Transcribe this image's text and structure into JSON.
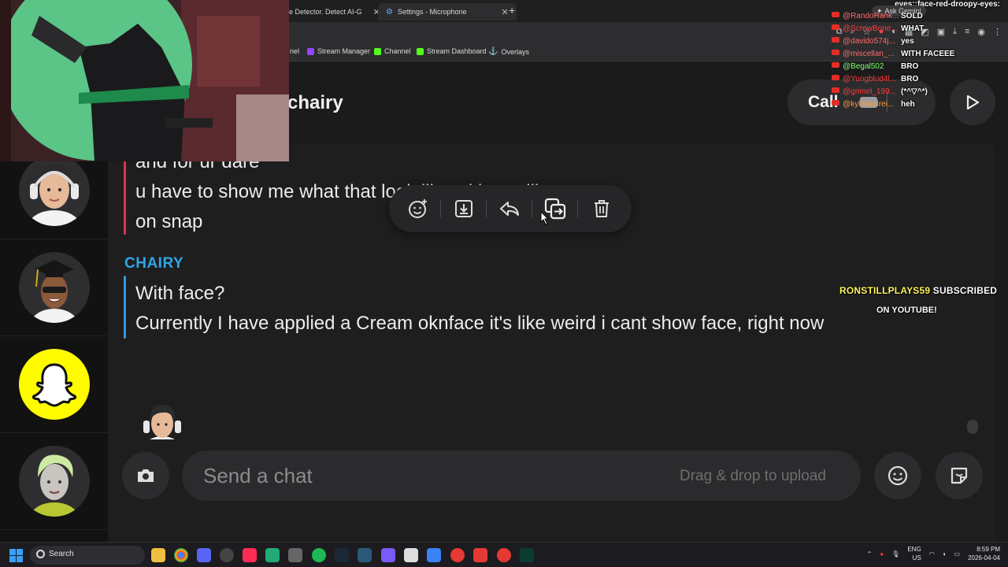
{
  "browser": {
    "tabs": [
      {
        "title": "ge Detector. Detect AI-G"
      },
      {
        "title": "Settings - Microphone"
      }
    ],
    "new_tab": "+",
    "bookmarks": [
      "nel",
      "Stream Manager",
      "Channel",
      "Stream Dashboard",
      "Overlays"
    ],
    "ask_gemini": "Ask Gemini"
  },
  "conversation": {
    "partner_name": "chairy",
    "call_label": "Call",
    "messages_prev": [
      "and for ur dare",
      "u have to show me what that look like with ur gilley",
      "on snap"
    ],
    "sender_name": "CHAIRY",
    "messages_reply": [
      "With face?",
      "Currently I have applied a Cream oknface it's like weird i cant show face, right now"
    ]
  },
  "message_actions": [
    "react",
    "save",
    "reply",
    "copy",
    "delete"
  ],
  "composer": {
    "placeholder": "Send a chat",
    "drag_hint": "Drag & drop to upload"
  },
  "stream_overlay": {
    "header": "eyes::face-red-droopy-eyes:",
    "chat": [
      {
        "user": "@RandoRank...",
        "message": "SOLD",
        "user_color": "#ff6b6b"
      },
      {
        "user": "@ScrewBone...",
        "message": "WHAT",
        "user_color": "#ff3b3b"
      },
      {
        "user": "@davido574j...",
        "message": "yes",
        "user_color": "#ff6b6b"
      },
      {
        "user": "@miscellan_...",
        "message": "WITH FACEEE",
        "user_color": "#ff6b6b"
      },
      {
        "user": "@Begal502",
        "message": "BRO",
        "user_color": "#7dff6b"
      },
      {
        "user": "@Yungblud4l...",
        "message": "BRO",
        "user_color": "#ff3b3b"
      },
      {
        "user": "@grimel_199...",
        "message": "(*^▽^*)",
        "user_color": "#ff3b3b"
      },
      {
        "user": "@kyleAndrei...",
        "message": "heh",
        "user_color": "#ff9a3b"
      }
    ],
    "sub_alert_name": "RONSTILLPLAYS59",
    "sub_alert_text": "SUBSCRIBED",
    "sub_alert_line2": "ON YOUTUBE!"
  },
  "taskbar": {
    "search_label": "Search",
    "lang": "ENG",
    "region": "US",
    "time": "8:59 PM",
    "date": "2026-04-04"
  },
  "colors": {
    "accent_blue": "#2fa6e6",
    "accent_red": "#e0324a",
    "snap_yellow": "#fffc00"
  }
}
